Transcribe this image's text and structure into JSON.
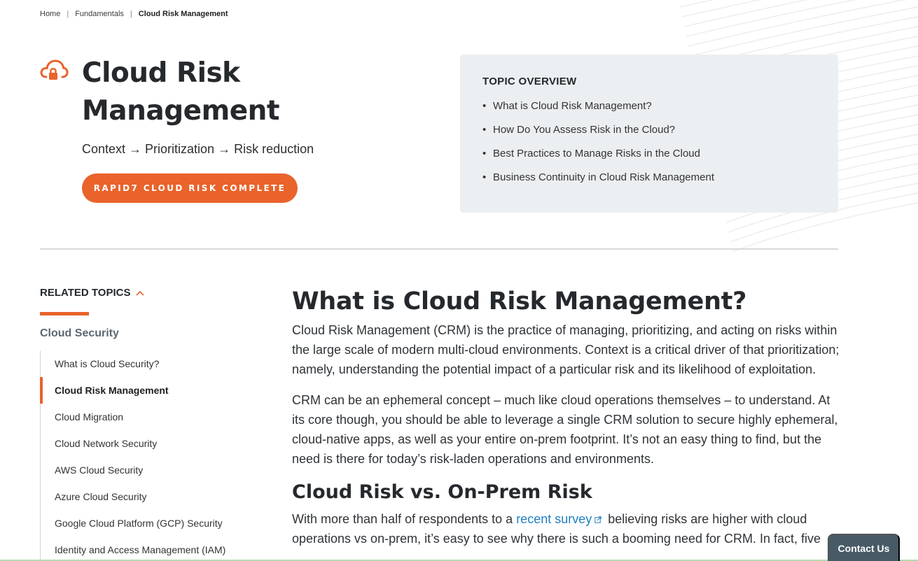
{
  "breadcrumb": {
    "home": "Home",
    "section": "Fundamentals",
    "current": "Cloud Risk Management",
    "separator": "|"
  },
  "hero": {
    "icon": "cloud-lock-icon",
    "title": "Cloud Risk Management",
    "subtitle": "Context → Prioritization → Risk reduction",
    "cta_label": "RAPID7 CLOUD RISK COMPLETE"
  },
  "overview": {
    "title": "TOPIC OVERVIEW",
    "items": [
      "What is Cloud Risk Management?",
      "How Do You Assess Risk in the Cloud?",
      "Best Practices to Manage Risks in the Cloud",
      "Business Continuity in Cloud Risk Management"
    ]
  },
  "sidebar": {
    "heading": "RELATED TOPICS",
    "category": "Cloud Security",
    "items": [
      "What is Cloud Security?",
      "Cloud Risk Management",
      "Cloud Migration",
      "Cloud Network Security",
      "AWS Cloud Security",
      "Azure Cloud Security",
      "Google Cloud Platform (GCP) Security",
      "Identity and Access Management (IAM)"
    ],
    "active_index": 1
  },
  "article": {
    "h1": "What is Cloud Risk Management?",
    "p1": "Cloud Risk Management (CRM) is the practice of managing, prioritizing, and acting on risks within the large scale of modern multi-cloud environments. Context is a critical driver of that prioritization; namely, understanding the potential impact of a particular risk and its likelihood of exploitation.",
    "p2": "CRM can be an ephemeral concept – much like cloud operations themselves – to understand. At its core though, you should be able to leverage a single CRM solution to secure highly ephemeral, cloud-native apps, as well as your entire on-prem footprint. It’s not an easy thing to find, but the need is there for today’s risk-laden operations and environments.",
    "h2": "Cloud Risk vs. On-Prem Risk",
    "p3_before": "With more than half of respondents to a ",
    "p3_link": "recent survey",
    "p3_after": " believing risks are higher with cloud operations vs on-prem, it’s easy to see why there is such a booming need for CRM. In fact, five"
  },
  "contact": {
    "label": "Contact Us"
  },
  "colors": {
    "accent": "#e9632b",
    "link": "#1f7fc2",
    "overview_bg": "#eceff1",
    "contact_bg": "#475a66"
  }
}
